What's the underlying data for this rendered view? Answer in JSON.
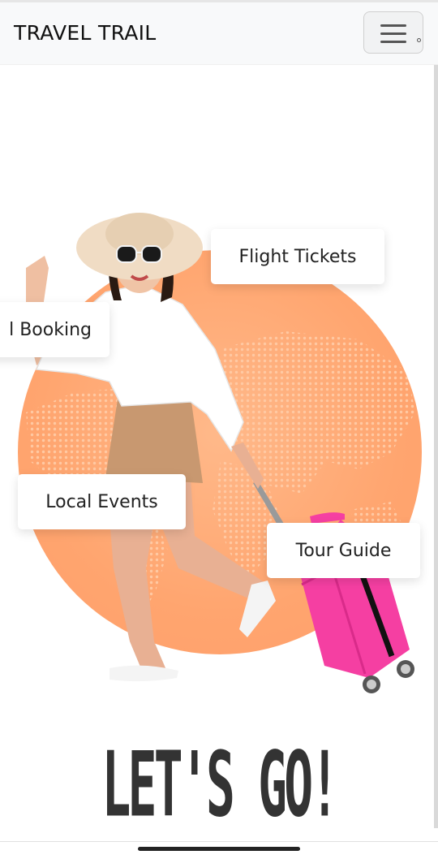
{
  "navbar": {
    "brand": "TRAVEL TRAIL",
    "menu_icon": "hamburger-menu-icon"
  },
  "hero": {
    "cards": {
      "flight": "Flight Tickets",
      "hotel": "l Booking",
      "events": "Local Events",
      "guide": "Tour Guide"
    },
    "headline": "LET'S GO!",
    "colors": {
      "circle": "#ffa56f",
      "suitcase": "#f53fa2",
      "shirt": "#ffffff",
      "shorts": "#c89870",
      "hat": "#f0dcc4"
    }
  }
}
